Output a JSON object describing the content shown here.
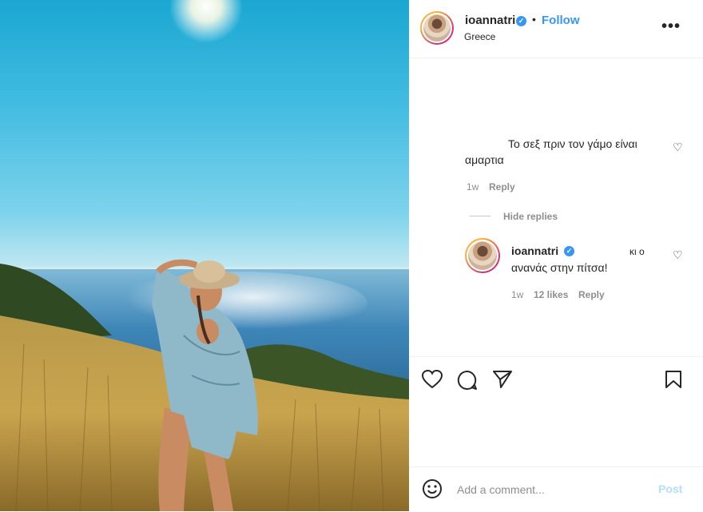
{
  "post": {
    "username": "ioannatri",
    "location": "Greece",
    "follow_label": "Follow",
    "separator": "•",
    "more_label": "•••"
  },
  "comments": [
    {
      "text_line1": "Το σεξ πριν τον γάμο είναι",
      "text_line2": "αμαρτια",
      "time": "1w",
      "reply_label": "Reply",
      "hide_replies_label": "Hide replies"
    }
  ],
  "reply": {
    "username": "ioannatri",
    "text_line1": "κι ο",
    "text_line2": "ανανάς στην πίτσα!",
    "time": "1w",
    "likes": "12 likes",
    "reply_label": "Reply"
  },
  "actions": {
    "icons": [
      "heart-icon",
      "comment-icon",
      "share-icon",
      "bookmark-icon"
    ]
  },
  "comment_box": {
    "placeholder": "Add a comment...",
    "post_label": "Post",
    "emoji_icon": "smiley-icon"
  },
  "colors": {
    "accent": "#3897f0",
    "post_disabled": "#b2dffc",
    "muted": "#8e8e8e"
  }
}
